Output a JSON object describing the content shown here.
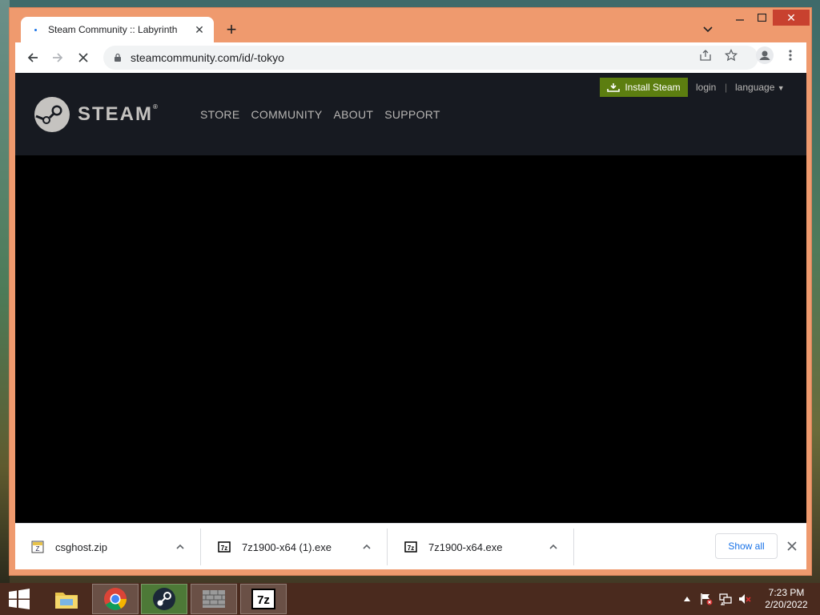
{
  "browser": {
    "tab": {
      "title": "Steam Community :: Labyrinth"
    },
    "address": "steamcommunity.com/id/-tokyo"
  },
  "steam": {
    "logo_text": "STEAM",
    "logo_mark": "®",
    "nav": [
      "STORE",
      "COMMUNITY",
      "ABOUT",
      "SUPPORT"
    ],
    "install_label": "Install Steam",
    "login_label": "login",
    "separator": "|",
    "language_label": "language"
  },
  "downloads": {
    "items": [
      {
        "name": "csghost.zip",
        "icon": "zip-file-icon"
      },
      {
        "name": "7z1900-x64 (1).exe",
        "icon": "7zip-file-icon"
      },
      {
        "name": "7z1900-x64.exe",
        "icon": "7zip-file-icon"
      }
    ],
    "show_all_label": "Show all"
  },
  "taskbar": {
    "apps": [
      "file-explorer-icon",
      "chrome-icon",
      "steam-icon",
      "firewall-icon",
      "7zip-icon"
    ],
    "time": "7:23 PM",
    "date": "2/20/2022"
  },
  "colors": {
    "window_frame": "#ef9a6e",
    "steam_header": "#171a21",
    "install_button": "#5c7e10",
    "taskbar": "#4a2a1e"
  }
}
